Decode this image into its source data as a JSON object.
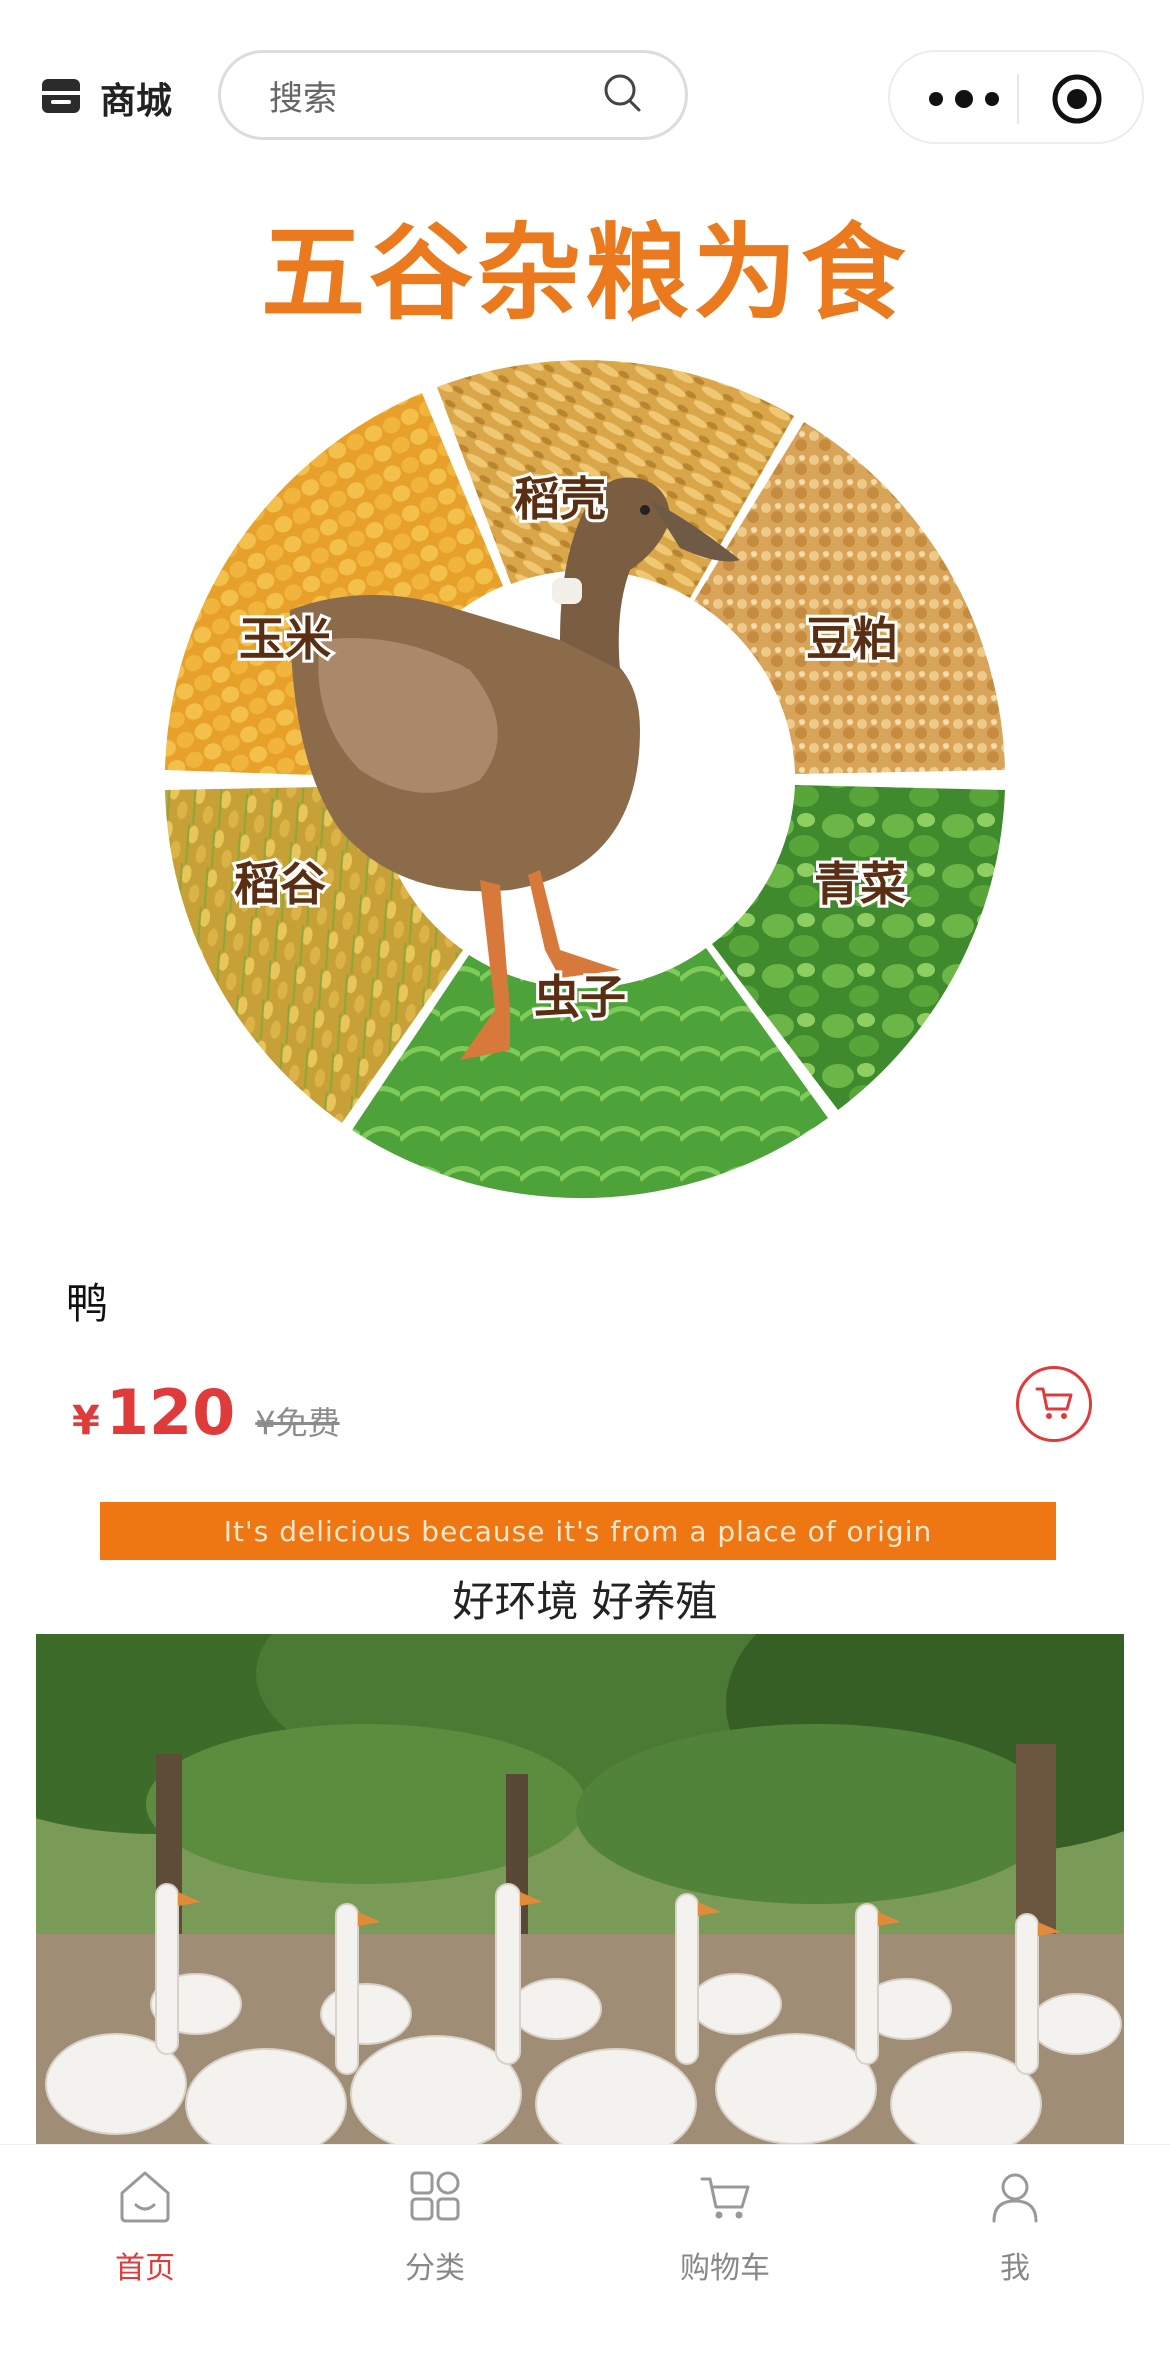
{
  "header": {
    "brand_label": "商城",
    "search_placeholder": "搜索",
    "brand_icon": "store-icon",
    "search_icon": "search-icon",
    "capsule_icons": [
      "more-dots-icon",
      "close-target-icon"
    ]
  },
  "hero": {
    "title": "五谷杂粮为食",
    "segments": [
      "稻壳",
      "豆粕",
      "青菜",
      "虫子",
      "稻谷",
      "玉米"
    ]
  },
  "product": {
    "name": "鸭",
    "currency": "¥",
    "price": "120",
    "original_price": "¥免费",
    "cart_icon": "cart-icon"
  },
  "description": {
    "banner": "It's delicious because it's from a place of origin",
    "subtitle": "好环境 好养殖"
  },
  "tabbar": {
    "items": [
      {
        "label": "首页",
        "icon": "home-icon",
        "active": true
      },
      {
        "label": "分类",
        "icon": "category-icon",
        "active": false
      },
      {
        "label": "购物车",
        "icon": "cart-icon",
        "active": false
      },
      {
        "label": "我",
        "icon": "user-icon",
        "active": false
      }
    ]
  },
  "colors": {
    "accent": "#e03b3b",
    "banner": "#ef7713",
    "title": "#ea7a1d"
  }
}
